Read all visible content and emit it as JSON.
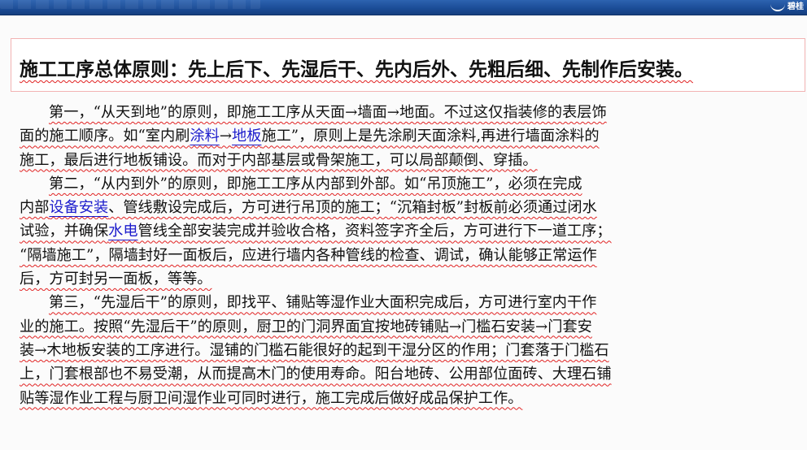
{
  "header": {
    "logo_text": "碧桂"
  },
  "principle": {
    "title": "施工工序总体原则：先上后下、先湿后干、先内后外、先粗后细、先制作后安装。"
  },
  "paragraphs": [
    {
      "lines": [
        [
          "第一，“从天到地”的原则，即施工工序从天面→墙面→地面。不过这仅指装修的表层饰"
        ],
        [
          "面的施工顺序。如“室内刷",
          {
            "link": "涂料"
          },
          "→",
          {
            "link": "地板"
          },
          "施工”，原则上是先涂刷天面涂料,再进行墙面涂料的"
        ],
        [
          "施工，最后进行地板铺设。而对于内部基层或骨架施工，可以局部颠倒、穿插。"
        ]
      ]
    },
    {
      "lines": [
        [
          "第二，“从内到外”的原则，即施工工序从内部到外部。如“吊顶施工”，必须在完成"
        ],
        [
          "内部",
          {
            "link": "设备安装"
          },
          "、管线敷设完成后，方可进行吊顶的施工；“沉箱封板”封板前必须通过闭水"
        ],
        [
          "试验，并确保",
          {
            "link": "水电"
          },
          "管线全部安装完成并验收合格，资料签字齐全后，方可进行下一道工序；"
        ],
        [
          "“隔墙施工”，隔墙封好一面板后，应进行墙内各种管线的检查、调试，确认能够正常运作"
        ],
        [
          "后，方可封另一面板，等等。"
        ]
      ]
    },
    {
      "lines": [
        [
          "第三，“先湿后干”的原则，即找平、铺贴等湿作业大面积完成后，方可进行室内干作"
        ],
        [
          "业的施工。按照“先湿后干”的原则，厨卫的门洞界面宜按地砖铺贴→门槛石安装→门套安"
        ],
        [
          "装→木地板安装的工序进行。湿铺的门槛石能很好的起到干湿分区的作用；门套落于门槛石"
        ],
        [
          "上，门套根部也不易受潮，从而提高木门的使用寿命。阳台地砖、公用部位面砖、大理石铺"
        ],
        [
          "贴等湿作业工程与厨卫间湿作业可同时进行，施工完成后做好成品保护工作。"
        ]
      ]
    }
  ]
}
